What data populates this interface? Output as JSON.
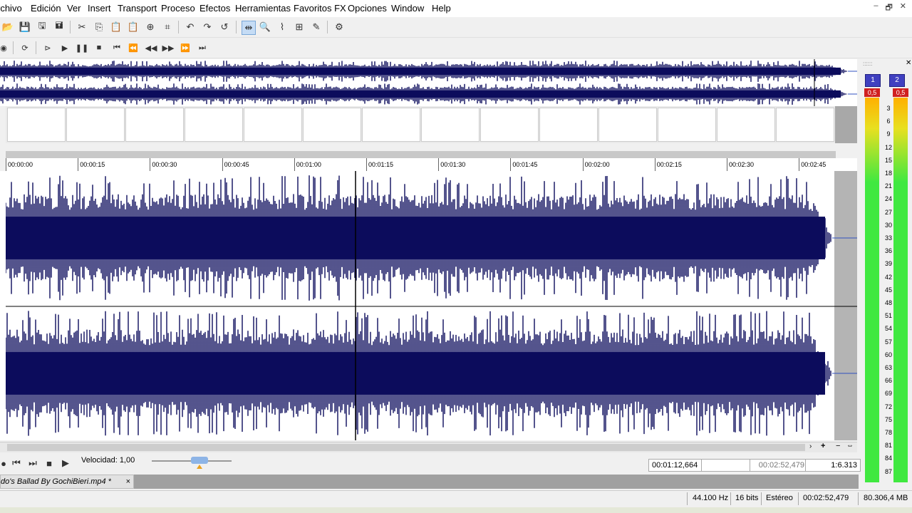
{
  "menu": [
    "rchivo",
    "Edición",
    "Ver",
    "Insert",
    "Transport",
    "Proceso",
    "Efectos",
    "Herramientas",
    "Favoritos FX",
    "Opciones",
    "Window",
    "Help"
  ],
  "window_controls": [
    "–",
    "🗗",
    "✕"
  ],
  "toolbar1_icons": [
    "open-icon",
    "save-icon",
    "save-as-icon",
    "save-all-icon",
    "cut-icon",
    "copy-icon",
    "paste-icon",
    "paste-special-icon",
    "mix-icon",
    "crop-icon",
    "undo-icon",
    "redo-icon",
    "repeat-icon",
    "edit-tool-icon",
    "zoom-tool-icon",
    "envelope-tool-icon",
    "magnify-tool-icon",
    "pencil-tool-icon",
    "properties-icon"
  ],
  "toolbar2_icons": [
    "record-icon",
    "loop-icon",
    "play-all-icon",
    "play-icon",
    "pause-icon",
    "stop-icon",
    "go-start-icon",
    "rewind-icon",
    "rewind-fast-icon",
    "forward-fast-icon",
    "forward-icon",
    "go-end-icon"
  ],
  "ruler_labels": [
    "00:00:00",
    "00:00:15",
    "00:00:30",
    "00:00:45",
    "00:01:00",
    "00:01:15",
    "00:01:30",
    "00:01:45",
    "00:02:00",
    "00:02:15",
    "00:02:30",
    "00:02:45"
  ],
  "meter": {
    "channels": [
      "1",
      "2"
    ],
    "peak": [
      "0,5",
      "0,5"
    ],
    "scale": [
      "3",
      "6",
      "9",
      "12",
      "15",
      "18",
      "21",
      "24",
      "27",
      "30",
      "33",
      "36",
      "39",
      "42",
      "45",
      "48",
      "51",
      "54",
      "57",
      "60",
      "63",
      "66",
      "69",
      "72",
      "75",
      "78",
      "81",
      "84",
      "87"
    ]
  },
  "transport": {
    "speed_label": "Velocidad: 1,00",
    "position": "00:01:12,664",
    "selection_start": "",
    "length": "00:02:52,479",
    "zoom_ratio": "1:6.313"
  },
  "file_tab": "do's Ballad By GochiBieri.mp4 *",
  "file_tab_close": "×",
  "status": {
    "sample_rate": "44.100 Hz",
    "bit_depth": "16 bits",
    "channels": "Estéreo",
    "duration": "00:02:52,479",
    "size": "80.306,4 MB"
  },
  "colors": {
    "waveform": "#0c0c5c",
    "meter_green": "#40e840",
    "peak_red": "#d02020"
  }
}
